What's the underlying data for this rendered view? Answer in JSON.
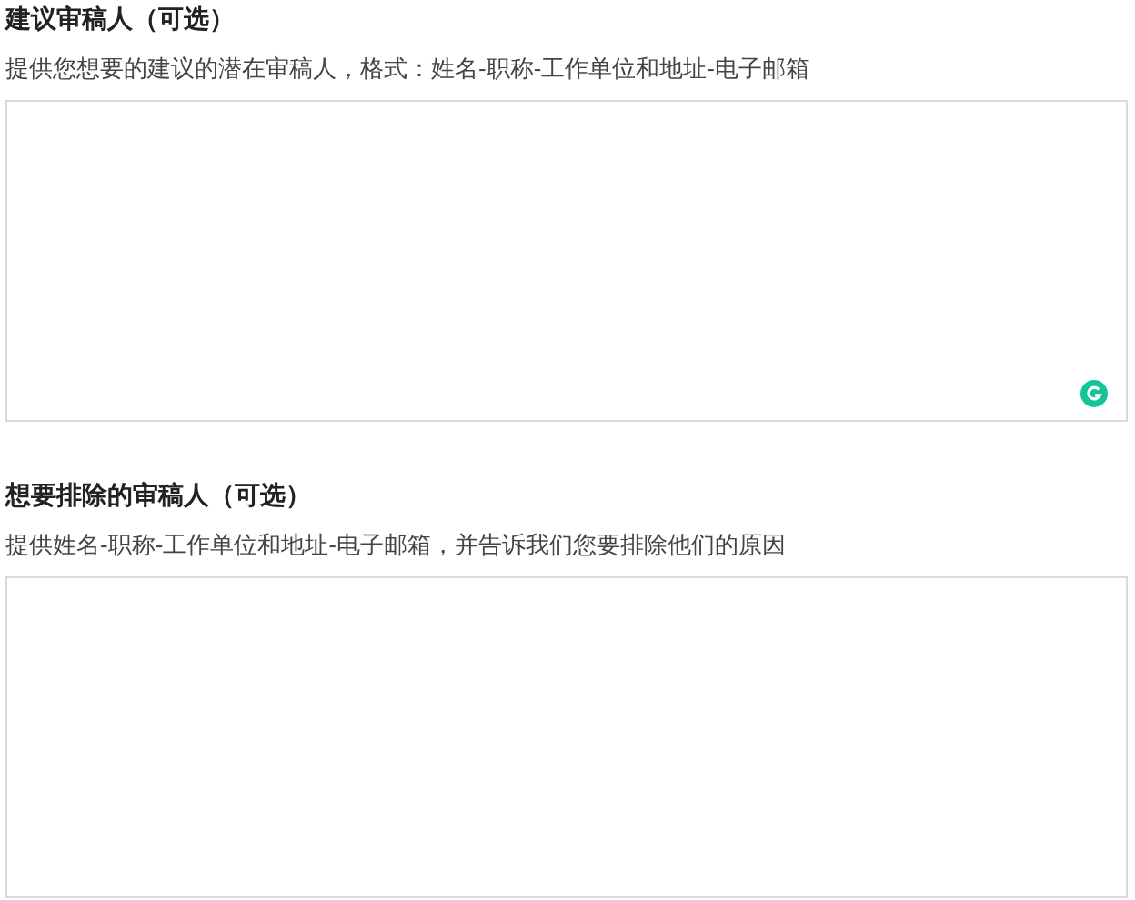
{
  "sections": [
    {
      "title": "建议审稿人（可选）",
      "hint": "提供您想要的建议的潜在审稿人，格式：姓名-职称-工作单位和地址-电子邮箱",
      "assist_badge": true
    },
    {
      "title": "想要排除的审稿人（可选）",
      "hint": "提供姓名-职称-工作单位和地址-电子邮箱，并告诉我们您要排除他们的原因",
      "assist_badge": false
    }
  ]
}
